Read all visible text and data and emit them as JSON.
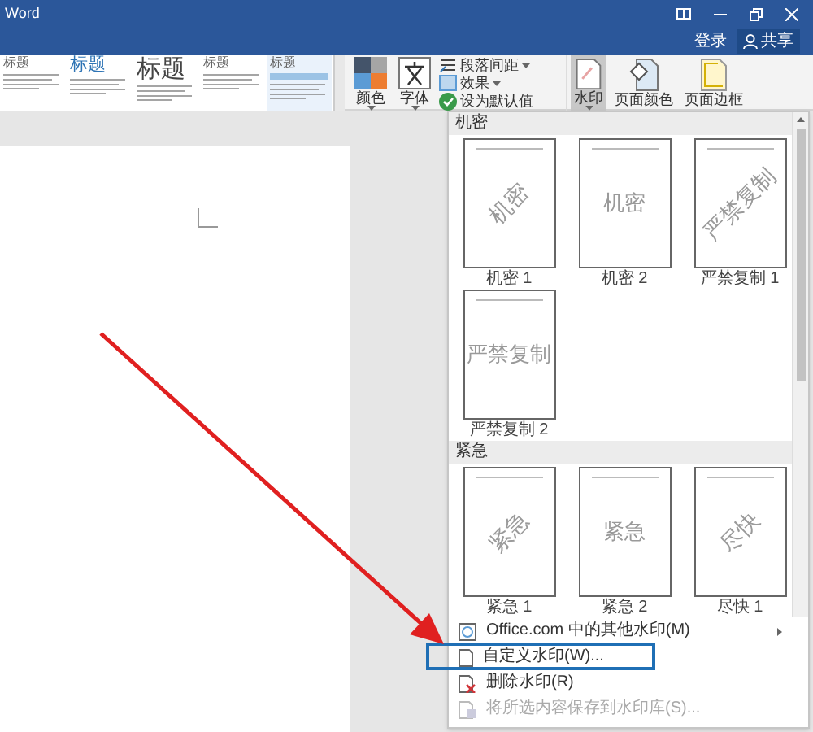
{
  "window": {
    "title": "Word",
    "signin": "登录",
    "share": "共享"
  },
  "ribbon": {
    "styles": [
      {
        "heading": "标题",
        "kind": "small",
        "selected": false
      },
      {
        "heading": "标题",
        "kind": "blue",
        "selected": false
      },
      {
        "heading": "标题",
        "kind": "large",
        "selected": false
      },
      {
        "heading": "标题",
        "kind": "small",
        "selected": false
      },
      {
        "heading": "标题",
        "kind": "small",
        "selected": true
      }
    ],
    "large_buttons": [
      {
        "label": "颜色",
        "kind": "colors",
        "selected": false
      },
      {
        "label": "字体",
        "kind": "fonts",
        "selected": false
      }
    ],
    "small_buttons": [
      {
        "label": "段落间距",
        "kind": "spacing",
        "dropdown": true
      },
      {
        "label": "效果",
        "kind": "effects",
        "dropdown": true
      },
      {
        "label": "设为默认值",
        "kind": "default",
        "dropdown": false
      }
    ],
    "page_buttons": [
      {
        "label": "水印",
        "kind": "watermark",
        "selected": true
      },
      {
        "label": "页面颜色",
        "kind": "pagecolor",
        "selected": false
      },
      {
        "label": "页面边框",
        "kind": "border",
        "selected": false
      }
    ]
  },
  "watermark_menu": {
    "sections": [
      {
        "title": "机密",
        "items": [
          {
            "label": "机密 1",
            "text": "机密",
            "diagonal": true
          },
          {
            "label": "机密 2",
            "text": "机密",
            "diagonal": false
          },
          {
            "label": "严禁复制 1",
            "text": "严禁复制",
            "diagonal": true
          },
          {
            "label": "严禁复制 2",
            "text": "严禁复制",
            "diagonal": false
          }
        ]
      },
      {
        "title": "紧急",
        "items": [
          {
            "label": "紧急 1",
            "text": "紧急",
            "diagonal": true
          },
          {
            "label": "紧急 2",
            "text": "紧急",
            "diagonal": false
          },
          {
            "label": "尽快 1",
            "text": "尽快",
            "diagonal": true
          }
        ]
      }
    ],
    "commands": [
      {
        "label": "Office.com 中的其他水印(M)",
        "kind": "online",
        "disabled": false,
        "submenu": true
      },
      {
        "label": "自定义水印(W)...",
        "kind": "custom",
        "disabled": false,
        "submenu": false
      },
      {
        "label": "删除水印(R)",
        "kind": "remove",
        "disabled": false,
        "submenu": false
      },
      {
        "label": "将所选内容保存到水印库(S)...",
        "kind": "save",
        "disabled": true,
        "submenu": false
      }
    ]
  }
}
